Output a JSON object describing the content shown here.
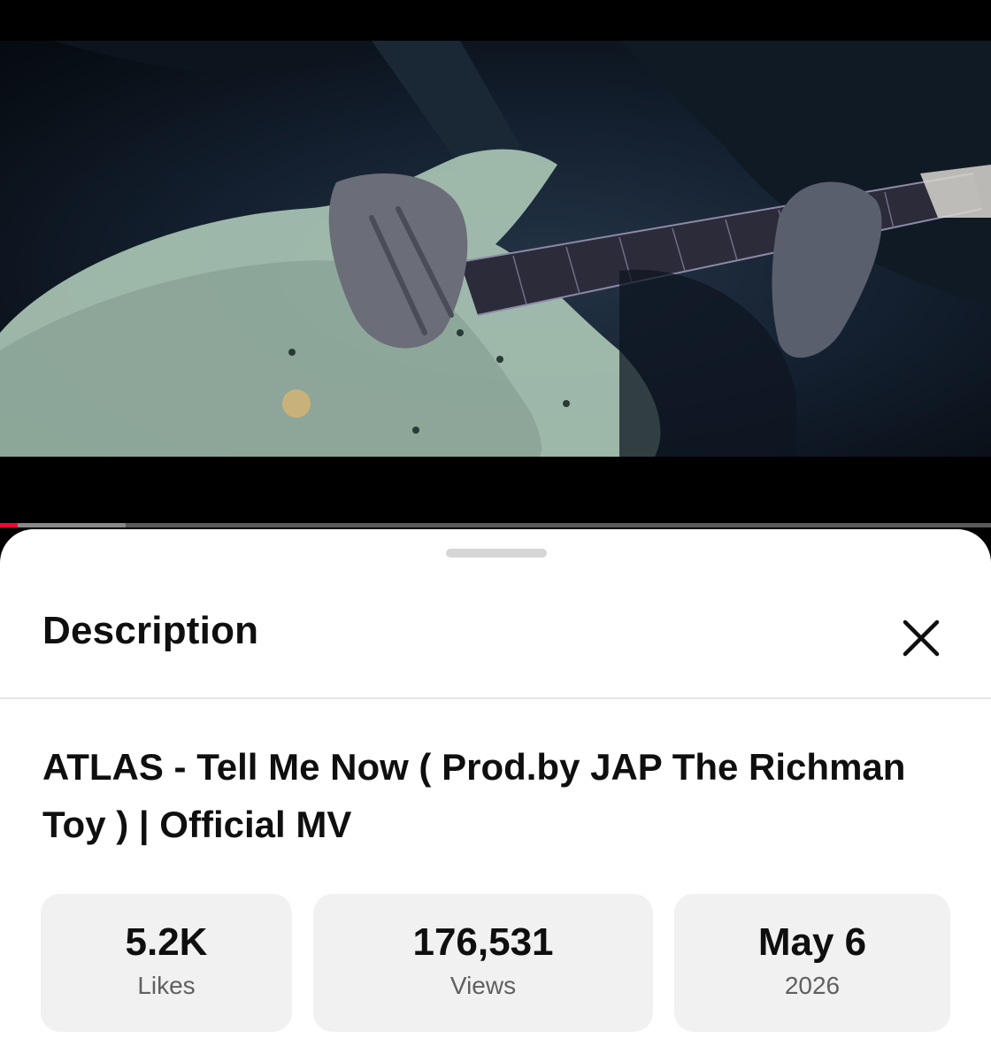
{
  "player": {
    "progress_played": 0.018,
    "progress_buffered": 0.127,
    "accent_color": "#ff0033",
    "frame_description_icon": "video-frame"
  },
  "sheet": {
    "title": "Description",
    "close_icon": "close-icon"
  },
  "video": {
    "title": "ATLAS - Tell Me Now ( Prod.by JAP The Richman Toy ) | Official MV"
  },
  "stats": [
    {
      "value": "5.2K",
      "label": "Likes"
    },
    {
      "value": "176,531",
      "label": "Views"
    },
    {
      "value": "May 6",
      "label": "2026"
    }
  ]
}
